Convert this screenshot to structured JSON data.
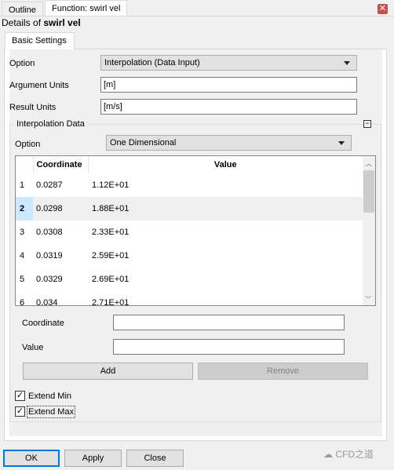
{
  "tabs": [
    {
      "label": "Outline"
    },
    {
      "label": "Function: swirl vel"
    }
  ],
  "details": {
    "prefix": "Details of",
    "name": "swirl vel"
  },
  "subtab": "Basic Settings",
  "option": {
    "label": "Option",
    "value": "Interpolation (Data Input)"
  },
  "argument_units": {
    "label": "Argument Units",
    "value": "[m]"
  },
  "result_units": {
    "label": "Result Units",
    "value": "[m/s]"
  },
  "interp": {
    "title": "Interpolation Data",
    "option": {
      "label": "Option",
      "value": "One Dimensional"
    },
    "columns": [
      "",
      "Coordinate",
      "Value"
    ],
    "rows": [
      {
        "n": "1",
        "c": "0.0287",
        "v": "1.12E+01"
      },
      {
        "n": "2",
        "c": "0.0298",
        "v": "1.88E+01"
      },
      {
        "n": "3",
        "c": "0.0308",
        "v": "2.33E+01"
      },
      {
        "n": "4",
        "c": "0.0319",
        "v": "2.59E+01"
      },
      {
        "n": "5",
        "c": "0.0329",
        "v": "2.69E+01"
      },
      {
        "n": "6",
        "c": "0.034",
        "v": "2.71E+01"
      }
    ],
    "selected_row": 2,
    "coordinate_label": "Coordinate",
    "coordinate_value": "",
    "value_label": "Value",
    "value_value": "",
    "add": "Add",
    "remove": "Remove",
    "extend_min": {
      "label": "Extend Min",
      "checked": true
    },
    "extend_max": {
      "label": "Extend Max",
      "checked": true
    }
  },
  "buttons": {
    "ok": "OK",
    "apply": "Apply",
    "close": "Close"
  },
  "watermark": "CFD之道"
}
